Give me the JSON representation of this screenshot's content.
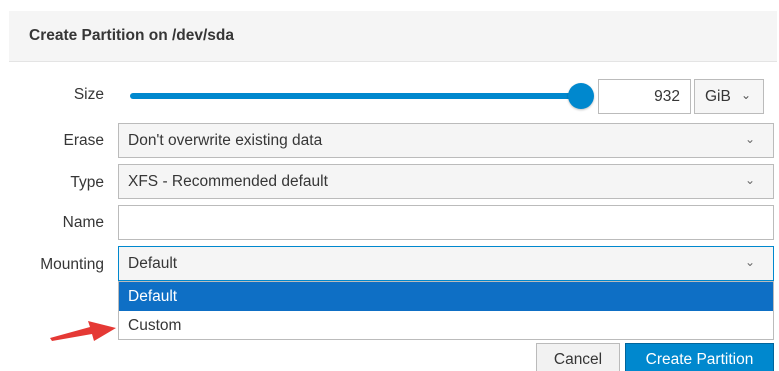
{
  "dialog": {
    "title": "Create Partition on /dev/sda"
  },
  "size": {
    "label": "Size",
    "value": "932",
    "unit": "GiB",
    "slider_fraction": 1.0
  },
  "erase": {
    "label": "Erase",
    "value": "Don't overwrite existing data"
  },
  "type": {
    "label": "Type",
    "value": "XFS - Recommended default"
  },
  "name": {
    "label": "Name",
    "value": ""
  },
  "mounting": {
    "label": "Mounting",
    "value": "Default",
    "options": [
      "Default",
      "Custom"
    ],
    "selected_index": 0
  },
  "buttons": {
    "cancel": "Cancel",
    "create": "Create Partition"
  },
  "colors": {
    "accent": "#0088ce",
    "selected": "#0e6fc5",
    "arrow": "#e53935"
  },
  "icons": {
    "dropdown": "chevron-down-icon",
    "annotation": "red-arrow-icon"
  },
  "glyphs": {
    "chevron": "⌄"
  }
}
